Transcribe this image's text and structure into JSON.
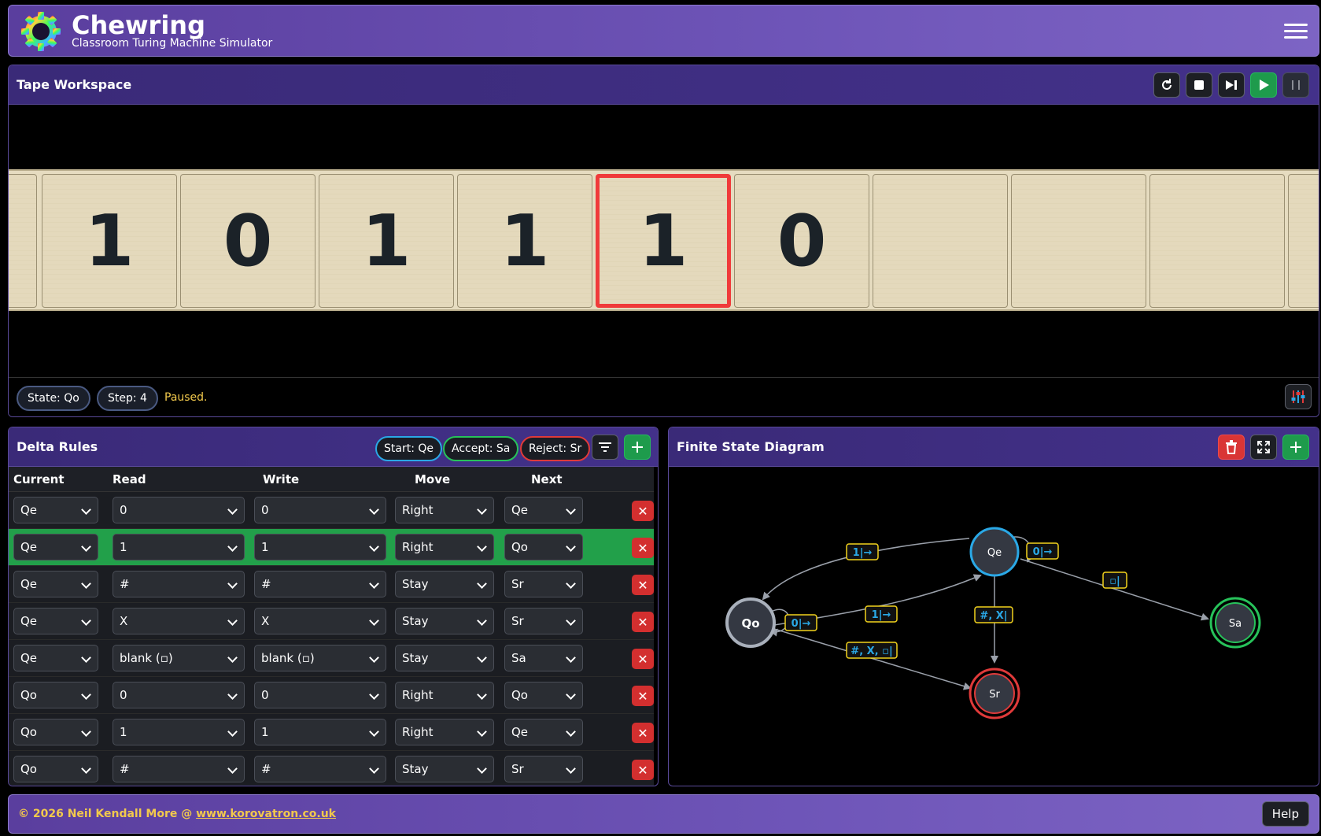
{
  "header": {
    "title": "Chewring",
    "subtitle": "Classroom Turing Machine Simulator"
  },
  "tape": {
    "title": "Tape Workspace",
    "cells": [
      "",
      "1",
      "0",
      "1",
      "1",
      "1",
      "0",
      "",
      "",
      "",
      ""
    ],
    "head_index": 5,
    "state_label": "State: Qo",
    "step_label": "Step: 4",
    "status": "Paused."
  },
  "rules": {
    "title": "Delta Rules",
    "start_label": "Start: Qe",
    "accept_label": "Accept: Sa",
    "reject_label": "Reject: Sr",
    "columns": [
      "Current",
      "Read",
      "Write",
      "Move",
      "Next"
    ],
    "rows": [
      {
        "current": "Qe",
        "read": "0",
        "write": "0",
        "move": "Right",
        "next": "Qe",
        "active": false
      },
      {
        "current": "Qe",
        "read": "1",
        "write": "1",
        "move": "Right",
        "next": "Qo",
        "active": true
      },
      {
        "current": "Qe",
        "read": "#",
        "write": "#",
        "move": "Stay",
        "next": "Sr",
        "active": false
      },
      {
        "current": "Qe",
        "read": "X",
        "write": "X",
        "move": "Stay",
        "next": "Sr",
        "active": false
      },
      {
        "current": "Qe",
        "read": "blank (▫)",
        "write": "blank (▫)",
        "move": "Stay",
        "next": "Sa",
        "active": false
      },
      {
        "current": "Qo",
        "read": "0",
        "write": "0",
        "move": "Right",
        "next": "Qo",
        "active": false
      },
      {
        "current": "Qo",
        "read": "1",
        "write": "1",
        "move": "Right",
        "next": "Qe",
        "active": false
      },
      {
        "current": "Qo",
        "read": "#",
        "write": "#",
        "move": "Stay",
        "next": "Sr",
        "active": false
      }
    ]
  },
  "diagram": {
    "title": "Finite State Diagram",
    "states": {
      "qo": "Qo",
      "qe": "Qe",
      "sa": "Sa",
      "sr": "Sr"
    },
    "labels": {
      "qo_qe_top": "1|→",
      "qe_self": "0|→",
      "qe_sa": "▫|",
      "qo_self": "0|→",
      "qo_qe_mid": "1|→",
      "qe_sr": "#, X|",
      "qo_sr": "#, X, ▫|"
    },
    "colors": {
      "accent_blue": "#2aa8e6",
      "accept": "#27c25a",
      "reject": "#e03a3a",
      "label_border": "#f2d21c"
    }
  },
  "footer": {
    "copyright": "© 2026 Neil Kendall More @ ",
    "link_text": "www.korovatron.co.uk",
    "help_label": "Help"
  }
}
